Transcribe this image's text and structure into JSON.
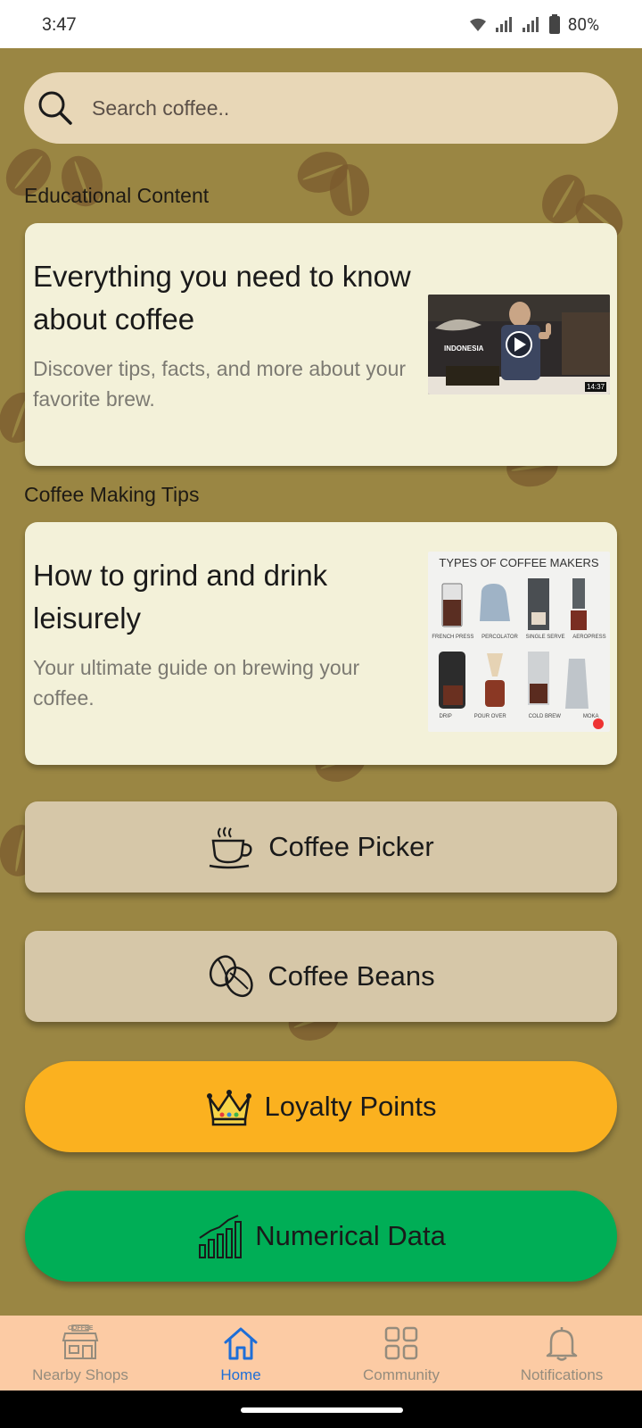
{
  "status_bar": {
    "time": "3:47",
    "battery": "80%"
  },
  "search": {
    "placeholder": "Search coffee.."
  },
  "sections": [
    {
      "label": "Educational Content",
      "card": {
        "title": "Everything you need to know about coffee",
        "description": "Discover tips, facts, and more about your favorite brew.",
        "video": {
          "overlay_text": "INDONESIA",
          "duration": "14:37"
        }
      }
    },
    {
      "label": "Coffee Making Tips",
      "card": {
        "title": "How to grind and drink leisurely",
        "description": "Your ultimate guide on brewing your coffee.",
        "infographic": {
          "title": "TYPES OF COFFEE MAKERS",
          "items": [
            "FRENCH PRESS",
            "PERCOLATOR",
            "SINGLE SERVE",
            "AEROPRESS",
            "DRIP",
            "POUR OVER",
            "COLD BREW",
            "MOKA"
          ]
        }
      }
    }
  ],
  "actions": [
    {
      "label": "Coffee Picker",
      "icon": "coffee-cup-icon",
      "color": "#d6c7a8"
    },
    {
      "label": "Coffee Beans",
      "icon": "coffee-beans-icon",
      "color": "#d6c7a8"
    },
    {
      "label": "Loyalty Points",
      "icon": "crown-icon",
      "color": "#fbb11f"
    },
    {
      "label": "Numerical Data",
      "icon": "chart-icon",
      "color": "#00ae56"
    }
  ],
  "bottom_nav": [
    {
      "label": "Nearby Shops",
      "icon": "shop-icon",
      "sign": "COFFEE",
      "active": false
    },
    {
      "label": "Home",
      "icon": "home-icon",
      "active": true
    },
    {
      "label": "Community",
      "icon": "grid-icon",
      "active": false
    },
    {
      "label": "Notifications",
      "icon": "bell-icon",
      "active": false
    }
  ],
  "colors": {
    "background": "#9a8643",
    "card": "#f3f1d9",
    "search": "#e8d7b7",
    "nav_bg": "#fccba4",
    "nav_active": "#1d6ed8"
  }
}
